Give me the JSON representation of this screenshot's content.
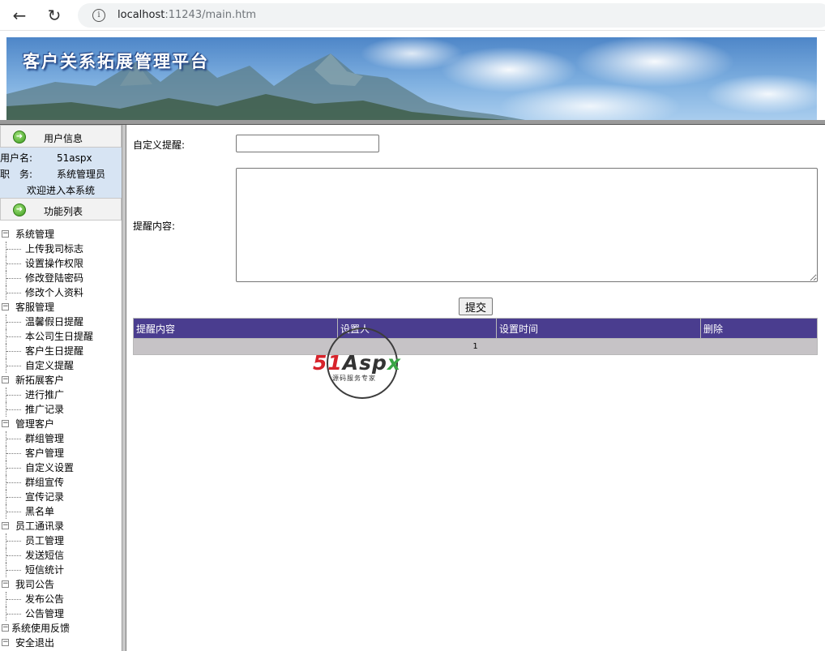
{
  "browser": {
    "url_host": "localhost",
    "url_rest": ":11243/main.htm"
  },
  "banner": {
    "title": "客户关系拓展管理平台"
  },
  "left": {
    "user_panel_title": "用户信息",
    "username_label": "用户名:",
    "username_value": "51aspx",
    "role_label": "职　务:",
    "role_value": "系统管理员",
    "welcome": "欢迎进入本系统",
    "function_panel_title": "功能列表",
    "tree": [
      {
        "label": "系统管理",
        "items": [
          "上传我司标志",
          "设置操作权限",
          "修改登陆密码",
          "修改个人资料"
        ]
      },
      {
        "label": "客服管理",
        "items": [
          "温馨假日提醒",
          "本公司生日提醒",
          "客户生日提醒",
          "自定义提醒"
        ]
      },
      {
        "label": "新拓展客户",
        "items": [
          "进行推广",
          "推广记录"
        ]
      },
      {
        "label": "管理客户",
        "items": [
          "群组管理",
          "客户管理",
          "自定义设置",
          "群组宣传",
          "宣传记录",
          "黑名单"
        ]
      },
      {
        "label": "员工通讯录",
        "items": [
          "员工管理",
          "发送短信",
          "短信统计"
        ]
      },
      {
        "label": "我司公告",
        "items": [
          "发布公告",
          "公告管理"
        ]
      },
      {
        "label": "系统使用反馈",
        "items": []
      },
      {
        "label": "安全退出",
        "items": []
      }
    ]
  },
  "form": {
    "name_label": "自定义提醒:",
    "name_value": "",
    "content_label": "提醒内容:",
    "content_value": "",
    "submit_label": "提交"
  },
  "grid": {
    "headers": [
      "提醒内容",
      "设置人",
      "设置时间",
      "删除"
    ],
    "pager": "1"
  },
  "watermark": {
    "brand_red": "51",
    "brand_dark": "Asp",
    "brand_green": "x",
    "tagline": "源码服务专家"
  },
  "colors": {
    "grid_header": "#4a3d8f",
    "user_panel_bg": "#d7e4f3",
    "pager_bg": "#c6c3c6"
  }
}
